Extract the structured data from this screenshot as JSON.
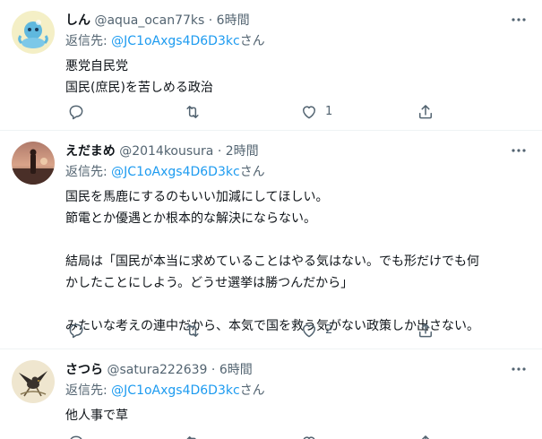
{
  "reply_prefix": "返信先:",
  "reply_suffix": "さん",
  "tweets": [
    {
      "name": "しん",
      "handle": "@aqua_ocan77ks",
      "dot": "·",
      "time": "6時間",
      "reply_to": "@JC1oAxgs4D6D3kc",
      "lines": [
        "悪党自民党",
        "国民(庶民)を苦しめる政治"
      ],
      "replies": "",
      "retweets": "",
      "likes": "1",
      "avatar_icon": "blue-creature-avatar"
    },
    {
      "name": "えだまめ",
      "handle": "@2014kousura",
      "dot": "·",
      "time": "2時間",
      "reply_to": "@JC1oAxgs4D6D3kc",
      "lines": [
        "国民を馬鹿にするのもいい加減にしてほしい。",
        "節電とか優遇とか根本的な解決にならない。",
        "",
        "結局は「国民が本当に求めていることはやる気はない。でも形だけでも何",
        "かしたことにしよう。どうせ選挙は勝つんだから」",
        "",
        "みたいな考えの連中だから、本気で国を救う気がない政策しか出さない。"
      ],
      "replies": "",
      "retweets": "",
      "likes": "2",
      "avatar_icon": "sunset-photo-avatar"
    },
    {
      "name": "さつら",
      "handle": "@satura222639",
      "dot": "·",
      "time": "6時間",
      "reply_to": "@JC1oAxgs4D6D3kc",
      "lines": [
        "他人事で草"
      ],
      "replies": "",
      "retweets": "",
      "likes": "",
      "avatar_icon": "bird-illustration-avatar"
    }
  ],
  "colors": {
    "text": "#0f1419",
    "secondary": "#536471",
    "link": "#1d9bf0",
    "divider": "#eff3f4"
  }
}
